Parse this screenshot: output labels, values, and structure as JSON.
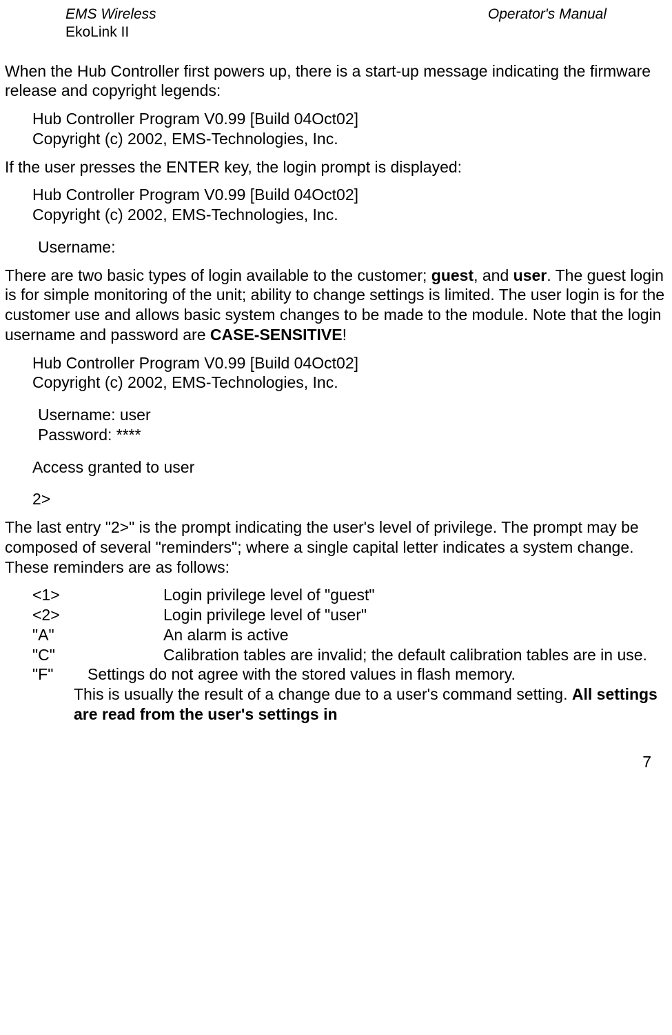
{
  "header": {
    "left1": "EMS Wireless",
    "left2": "EkoLink II",
    "right": "Operator's Manual"
  },
  "para1": "When the Hub Controller first powers up, there is a start-up message indicating the firmware release and copyright legends:",
  "block1": {
    "l1": "Hub Controller Program V0.99 [Build 04Oct02]",
    "l2": "Copyright (c) 2002, EMS-Technologies, Inc."
  },
  "para2": "If the user presses the ENTER key, the login prompt is displayed:",
  "block2": {
    "l1": "Hub Controller Program V0.99 [Build 04Oct02]",
    "l2": "Copyright (c) 2002, EMS-Technologies, Inc.",
    "l3": "Username:"
  },
  "para3": {
    "t1": "There are two basic types of login available to the customer; ",
    "b1": "guest",
    "t2": ", and ",
    "b2": "user",
    "t3": ".  The guest login is for simple monitoring of the unit; ability to change settings is limited.  The user login is for the customer use and allows basic system changes to be made to the module.  Note that the login username and password are ",
    "b3": "CASE-SENSITIVE",
    "t4": "!"
  },
  "block3": {
    "l1": "Hub Controller Program V0.99 [Build 04Oct02]",
    "l2": "Copyright (c) 2002, EMS-Technologies, Inc.",
    "l3": "Username: user",
    "l4": "Password: ****",
    "l5": "Access granted to user",
    "l6": "2>"
  },
  "para4": "The last entry \"2>\" is the prompt indicating the user's level of privilege.  The prompt may be composed of several \"reminders\"; where a single capital letter indicates a system change.  These reminders are as follows:",
  "reminders": {
    "r1": {
      "key": "<1>",
      "desc": "Login privilege level of \"guest\""
    },
    "r2": {
      "key": "<2>",
      "desc": "Login privilege level of \"user\""
    },
    "r3": {
      "key": "\"A\"",
      "desc": "An alarm is active"
    },
    "r4": {
      "key": "\"C\"",
      "desc": "Calibration tables are invalid; the default calibration tables are in use."
    },
    "r5": {
      "key": "\"F\"",
      "desc1": "Settings do not agree with the stored values in flash memory.",
      "desc2": "This is usually the result of a change due to a user's command setting.  ",
      "bold": "All settings are read from the user's settings in"
    }
  },
  "pageNum": "7"
}
